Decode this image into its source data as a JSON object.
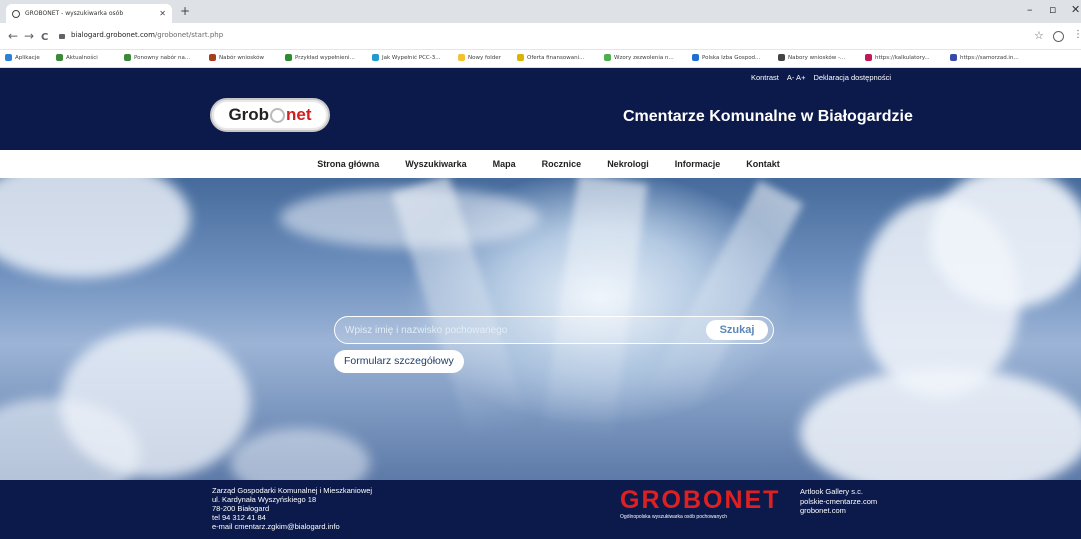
{
  "browser": {
    "tab_title": "GROBONET - wyszukiwarka osób",
    "tab_close": "✕",
    "new_tab": "+",
    "url_host": "bialogard.grobonet.com",
    "url_path": "/grobonet/start.php",
    "back": "←",
    "forward": "→",
    "reload": "C",
    "star": "☆",
    "menu": "⋮",
    "minimize": "–",
    "restore": "▫",
    "close": "✕"
  },
  "bookmarks": [
    {
      "label": "Aplikacje",
      "color": "#2d7fd8"
    },
    {
      "label": "Aktualności",
      "color": "#3a8a3a"
    },
    {
      "label": "Ponowny nabór na...",
      "color": "#3a8a3a"
    },
    {
      "label": "Nabór wniosków",
      "color": "#a63f1c"
    },
    {
      "label": "Przykład wypełnieni...",
      "color": "#2e8b2e"
    },
    {
      "label": "Jak Wypełnić PCC-3...",
      "color": "#1f9bd1"
    },
    {
      "label": "Nowy folder",
      "color": "#f2c230"
    },
    {
      "label": "Oferta finansowani...",
      "color": "#d9b400"
    },
    {
      "label": "Wzory zezwolenia n...",
      "color": "#4caf50"
    },
    {
      "label": "Polska Izba Gospod...",
      "color": "#1d6fd1"
    },
    {
      "label": "Nabory wniosków -...",
      "color": "#444444"
    },
    {
      "label": "https://kalkulatory...",
      "color": "#c2185b"
    },
    {
      "label": "https://samorzad.in...",
      "color": "#3949ab"
    }
  ],
  "header": {
    "util_links": [
      "Kontrast",
      "A- A+",
      "Deklaracja dostępności"
    ],
    "logo_grob": "Grob",
    "logo_net": "net",
    "title": "Cmentarze Komunalne w Białogardzie"
  },
  "nav": [
    "Strona główna",
    "Wyszukiwarka",
    "Mapa",
    "Rocznice",
    "Nekrologi",
    "Informacje",
    "Kontakt"
  ],
  "search": {
    "placeholder": "Wpisz imię i nazwisko pochowanego",
    "button": "Szukaj",
    "detail_button": "Formularz szczegółowy"
  },
  "footer": {
    "address": [
      "Zarząd Gospodarki Komunalnej i Mieszkaniowej",
      "ul. Kardynała Wyszyńskiego 18",
      "78-200 Białogard",
      "tel 94 312 41 84",
      "e-mail cmentarz.zgkim@bialogard.info"
    ],
    "brand": "GROBONET",
    "brand_tag": "Ogólnopolska wyszukiwarka osób pochowanych",
    "right": [
      "Artlook Gallery s.c.",
      "polskie-cmentarze.com",
      "grobonet.com"
    ]
  }
}
